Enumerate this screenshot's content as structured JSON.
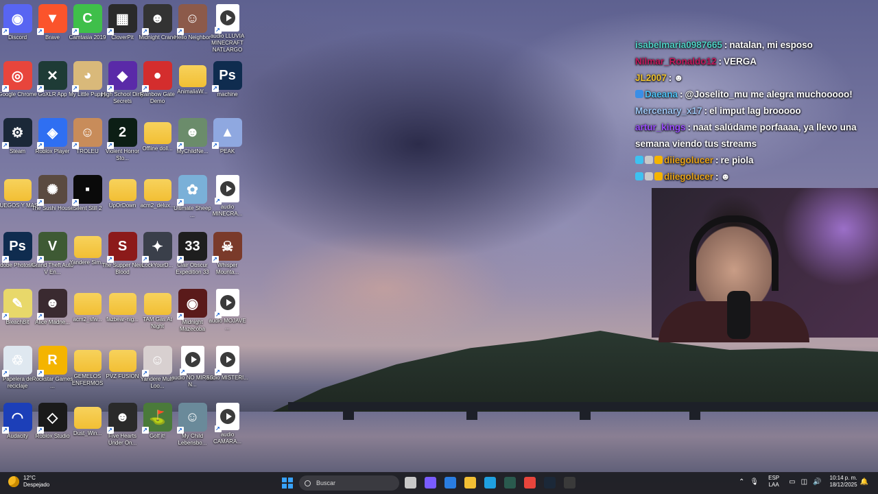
{
  "desktop": {
    "icons": [
      {
        "label": "Discord",
        "icon": "discord-icon",
        "color": "#5865f2",
        "glyph": "◉",
        "col": 0,
        "row": 0
      },
      {
        "label": "Brave",
        "icon": "brave-icon",
        "color": "#fb542b",
        "glyph": "▼",
        "col": 1,
        "row": 0
      },
      {
        "label": "Camtasia 2019",
        "icon": "camtasia-icon",
        "color": "#3fbf4a",
        "glyph": "C",
        "col": 2,
        "row": 0
      },
      {
        "label": "CloverPit",
        "icon": "cloverpit-icon",
        "color": "#2a2a2a",
        "glyph": "▦",
        "col": 3,
        "row": 0
      },
      {
        "label": "Midnight Crane",
        "icon": "midnight-crane-icon",
        "color": "#333333",
        "glyph": "☻",
        "col": 4,
        "row": 0
      },
      {
        "label": "Hello Neighbor",
        "icon": "hello-neighbor-icon",
        "color": "#8c5a4a",
        "glyph": "☺",
        "col": 5,
        "row": 0
      },
      {
        "label": "audio LLUVIA MINECRAFT NATLARGO",
        "icon": "audio-file-icon",
        "color": "#ffffff",
        "glyph": "",
        "col": 6,
        "row": 0,
        "type": "audio"
      },
      {
        "label": "Google Chrome",
        "icon": "chrome-icon",
        "color": "#e8453c",
        "glyph": "◎",
        "col": 0,
        "row": 1
      },
      {
        "label": "GoXLR App",
        "icon": "goxlr-icon",
        "color": "#1e3b36",
        "glyph": "✕",
        "col": 1,
        "row": 1
      },
      {
        "label": "My Little Puppy",
        "icon": "puppy-icon",
        "color": "#d9b97a",
        "glyph": "◕",
        "col": 2,
        "row": 1
      },
      {
        "label": "High School Dirty Secrets",
        "icon": "high-school-icon",
        "color": "#5a2aa8",
        "glyph": "◆",
        "col": 3,
        "row": 1
      },
      {
        "label": "Rainbow Gate Demo",
        "icon": "rainbow-gate-icon",
        "color": "#d42d2d",
        "glyph": "●",
        "col": 4,
        "row": 1
      },
      {
        "label": "AnimaliaW...",
        "icon": "folder-icon",
        "color": "#f2bf34",
        "glyph": "",
        "col": 5,
        "row": 1,
        "type": "folder"
      },
      {
        "label": "machine",
        "icon": "photoshop-file-icon",
        "color": "#0f2c4f",
        "glyph": "Ps",
        "col": 6,
        "row": 1
      },
      {
        "label": "Steam",
        "icon": "steam-icon",
        "color": "#1b2838",
        "glyph": "⚙",
        "col": 0,
        "row": 2
      },
      {
        "label": "Roblox Player",
        "icon": "roblox-player-icon",
        "color": "#2f6ff2",
        "glyph": "◈",
        "col": 1,
        "row": 2
      },
      {
        "label": "TROLEU",
        "icon": "troleu-icon",
        "color": "#c88c5a",
        "glyph": "☺",
        "col": 2,
        "row": 2
      },
      {
        "label": "Violent Horror Sto...",
        "icon": "violent-horror-icon",
        "color": "#0c1e15",
        "glyph": "2",
        "col": 3,
        "row": 2
      },
      {
        "label": "Offline doll...",
        "icon": "folder-icon",
        "color": "#f2bf34",
        "glyph": "",
        "col": 4,
        "row": 2,
        "type": "folder"
      },
      {
        "label": "MyChildNe...",
        "icon": "my-child-icon",
        "color": "#6b8c6b",
        "glyph": "☻",
        "col": 5,
        "row": 2
      },
      {
        "label": "PEAK",
        "icon": "peak-icon",
        "color": "#8fa8e0",
        "glyph": "▲",
        "col": 6,
        "row": 2
      },
      {
        "label": "JUEGOS Y MAS",
        "icon": "folder-icon",
        "color": "#f2bf34",
        "glyph": "",
        "col": 0,
        "row": 3,
        "type": "folder"
      },
      {
        "label": "The Sushi House",
        "icon": "sushi-house-icon",
        "color": "#5a4a40",
        "glyph": "✺",
        "col": 1,
        "row": 3
      },
      {
        "label": "Silent Still 2",
        "icon": "silent-still-icon",
        "color": "#0a0a0a",
        "glyph": "▪",
        "col": 2,
        "row": 3
      },
      {
        "label": "UpOrDown",
        "icon": "folder-icon",
        "color": "#f2bf34",
        "glyph": "",
        "col": 3,
        "row": 3,
        "type": "folder"
      },
      {
        "label": "acm2_delux...",
        "icon": "folder-icon",
        "color": "#f2bf34",
        "glyph": "",
        "col": 4,
        "row": 3,
        "type": "folder"
      },
      {
        "label": "Ultimate Sheep ...",
        "icon": "ultimate-sheep-icon",
        "color": "#7ab0d8",
        "glyph": "✿",
        "col": 5,
        "row": 3
      },
      {
        "label": "audio MINECRA...",
        "icon": "audio-file-icon",
        "color": "#ffffff",
        "glyph": "",
        "col": 6,
        "row": 3,
        "type": "audio"
      },
      {
        "label": "Adobe Photosh...",
        "icon": "photoshop-icon",
        "color": "#0f2c4f",
        "glyph": "Ps",
        "col": 0,
        "row": 4
      },
      {
        "label": "Grand Theft Auto V En...",
        "icon": "gta-v-icon",
        "color": "#3e5a34",
        "glyph": "V",
        "col": 1,
        "row": 4
      },
      {
        "label": "Yandere Sim...",
        "icon": "folder-icon",
        "color": "#f2bf34",
        "glyph": "",
        "col": 2,
        "row": 4,
        "type": "folder"
      },
      {
        "label": "The Supper New Blood",
        "icon": "supper-icon",
        "color": "#8c1a1a",
        "glyph": "S",
        "col": 3,
        "row": 4
      },
      {
        "label": "LockYourD...",
        "icon": "lock-your-door-icon",
        "color": "#3a3f4a",
        "glyph": "✦",
        "col": 4,
        "row": 4
      },
      {
        "label": "Clair Obscur Expedition 33",
        "icon": "clair-obscur-icon",
        "color": "#1e1e1e",
        "glyph": "33",
        "col": 5,
        "row": 4
      },
      {
        "label": "Whisper Mounta...",
        "icon": "whisper-mountain-icon",
        "color": "#7a3a2a",
        "glyph": "☠",
        "col": 6,
        "row": 4
      },
      {
        "label": "BleachBit",
        "icon": "bleachbit-icon",
        "color": "#e8d86a",
        "glyph": "✎",
        "col": 0,
        "row": 5
      },
      {
        "label": "Alice Madne...",
        "icon": "alice-madness-icon",
        "color": "#3a2a30",
        "glyph": "☻",
        "col": 1,
        "row": 5
      },
      {
        "label": "acm2_sfw...",
        "icon": "folder-icon",
        "color": "#f2bf34",
        "glyph": "",
        "col": 2,
        "row": 5,
        "type": "folder"
      },
      {
        "label": "fazbear-nig...",
        "icon": "folder-icon",
        "color": "#f2bf34",
        "glyph": "",
        "col": 3,
        "row": 5,
        "type": "folder"
      },
      {
        "label": "TAM Gas At Night",
        "icon": "folder-icon",
        "color": "#f2bf34",
        "glyph": "",
        "col": 4,
        "row": 5,
        "type": "folder"
      },
      {
        "label": "Midnight Mazecoba",
        "icon": "midnight-maze-icon",
        "color": "#5a1a1a",
        "glyph": "◉",
        "col": 5,
        "row": 5
      },
      {
        "label": "audio MOJAVE ...",
        "icon": "audio-file-icon",
        "color": "#ffffff",
        "glyph": "",
        "col": 6,
        "row": 5,
        "type": "audio"
      },
      {
        "label": "Papelera de reciclaje",
        "icon": "recycle-bin-icon",
        "color": "#dfe8f0",
        "glyph": "♲",
        "col": 0,
        "row": 6
      },
      {
        "label": "Rockstar Games ...",
        "icon": "rockstar-icon",
        "color": "#f4b400",
        "glyph": "R",
        "col": 1,
        "row": 6
      },
      {
        "label": "GEMELOS ENFERMOS",
        "icon": "folder-icon",
        "color": "#f2bf34",
        "glyph": "",
        "col": 2,
        "row": 6,
        "type": "folder"
      },
      {
        "label": "PVZ FUSION",
        "icon": "folder-icon",
        "color": "#f2bf34",
        "glyph": "",
        "col": 3,
        "row": 6,
        "type": "folder"
      },
      {
        "label": "Yandere Mult-Loo...",
        "icon": "yandere-icon",
        "color": "#d8d0d0",
        "glyph": "☺",
        "col": 4,
        "row": 6
      },
      {
        "label": "audio NO MIRES N...",
        "icon": "audio-file-icon",
        "color": "#ffffff",
        "glyph": "",
        "col": 5,
        "row": 6,
        "type": "audio"
      },
      {
        "label": "audio MISTERI...",
        "icon": "audio-file-icon",
        "color": "#ffffff",
        "glyph": "",
        "col": 6,
        "row": 6,
        "type": "audio"
      },
      {
        "label": "Audacity",
        "icon": "audacity-icon",
        "color": "#1c3fb8",
        "glyph": "◠",
        "col": 0,
        "row": 7
      },
      {
        "label": "Roblox Studio",
        "icon": "roblox-studio-icon",
        "color": "#1a1a1a",
        "glyph": "◇",
        "col": 1,
        "row": 7
      },
      {
        "label": "Dust_Win...",
        "icon": "folder-icon",
        "color": "#f2bf34",
        "glyph": "",
        "col": 2,
        "row": 7,
        "type": "folder"
      },
      {
        "label": "Five Hearts Under On...",
        "icon": "five-hearts-icon",
        "color": "#2a2a2a",
        "glyph": "☻",
        "col": 3,
        "row": 7
      },
      {
        "label": "Golf it!",
        "icon": "golf-it-icon",
        "color": "#4a7a3a",
        "glyph": "⛳",
        "col": 4,
        "row": 7
      },
      {
        "label": "My Child Lebensbo...",
        "icon": "my-child-lebensborn-icon",
        "color": "#6a8a9a",
        "glyph": "☺",
        "col": 5,
        "row": 7
      },
      {
        "label": "audio CAMARA...",
        "icon": "audio-file-icon",
        "color": "#ffffff",
        "glyph": "",
        "col": 6,
        "row": 7,
        "type": "audio"
      }
    ]
  },
  "chat": {
    "messages": [
      {
        "user": "isabelmaria0987665",
        "user_color": "#4fd1c5",
        "text": "natalan, mi esposo",
        "badges": []
      },
      {
        "user": "Nilmar_Ronaldo12",
        "user_color": "#c2185b",
        "text": "VERGA",
        "badges": []
      },
      {
        "user": "JL2007",
        "user_color": "#f0c330",
        "text": "☻",
        "badges": []
      },
      {
        "user": "Daeana",
        "user_color": "#4fc3f7",
        "text": "@Joselito_mu me alegra muchooooo!",
        "badges": [
          "#3a8ee6"
        ]
      },
      {
        "user": "Mercenary_x17",
        "user_color": "#9ec6f5",
        "text": "el imput lag brooooo",
        "badges": []
      },
      {
        "user": "artur_kings",
        "user_color": "#9b4dff",
        "text": "naat salúdame porfaaaa, ya llevo una semana viendo tus streams",
        "badges": []
      },
      {
        "user": "diiegolucer",
        "user_color": "#e8a317",
        "text": "re piola",
        "badges": [
          "#3ec1f0",
          "#c9c9c9",
          "#f5b400"
        ]
      },
      {
        "user": "diiegolucer",
        "user_color": "#e8a317",
        "text": "☻",
        "badges": [
          "#3ec1f0",
          "#c9c9c9",
          "#f5b400"
        ]
      }
    ],
    "separator": ":"
  },
  "taskbar": {
    "weather": {
      "temp": "12°C",
      "condition": "Despejado"
    },
    "search_placeholder": "Buscar",
    "apps": [
      {
        "name": "task-view-icon",
        "color": "#c8c8c8"
      },
      {
        "name": "copilot-icon",
        "color": "#7a5cff"
      },
      {
        "name": "store-icon",
        "color": "#2a7de1"
      },
      {
        "name": "file-explorer-icon",
        "color": "#f2bf34"
      },
      {
        "name": "edge-icon",
        "color": "#1fa0e0"
      },
      {
        "name": "goxlr-taskbar-icon",
        "color": "#2a5a4e"
      },
      {
        "name": "chrome-taskbar-icon",
        "color": "#e8453c"
      },
      {
        "name": "steam-taskbar-icon",
        "color": "#1b2838"
      },
      {
        "name": "obs-icon",
        "color": "#3a3a3a"
      }
    ],
    "language": {
      "line1": "ESP",
      "line2": "LAA"
    },
    "clock": {
      "time": "10:14 p. m.",
      "date": "18/12/2025"
    }
  }
}
